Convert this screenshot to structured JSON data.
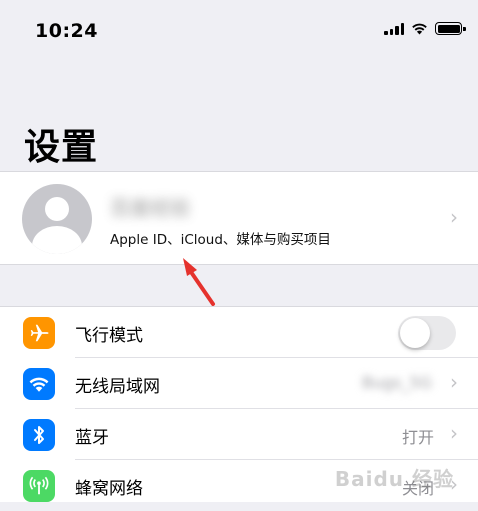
{
  "status_bar": {
    "time": "10:24",
    "icons": [
      "cellular-signal-icon",
      "wifi-icon",
      "battery-icon"
    ]
  },
  "page": {
    "title": "设置"
  },
  "account": {
    "name": "百度经验",
    "subtitle": "Apple ID、iCloud、媒体与购买项目"
  },
  "settings": [
    {
      "label": "飞行模式",
      "icon": "airplane-icon",
      "icon_color": "#ff9500",
      "control": "toggle",
      "on": false
    },
    {
      "label": "无线局域网",
      "icon": "wifi-icon",
      "icon_color": "#007aff",
      "value": "Bugs_5G"
    },
    {
      "label": "蓝牙",
      "icon": "bluetooth-icon",
      "icon_color": "#007aff",
      "value": "打开"
    },
    {
      "label": "蜂窝网络",
      "icon": "cellular-icon",
      "icon_color": "#4cd964",
      "value": "关闭"
    }
  ],
  "watermark": "Baidu 经验",
  "colors": {
    "annotation_arrow": "#e5322d",
    "airplane": "#ff9500",
    "wifi": "#007aff",
    "bluetooth": "#007aff",
    "cellular": "#4cd964"
  }
}
